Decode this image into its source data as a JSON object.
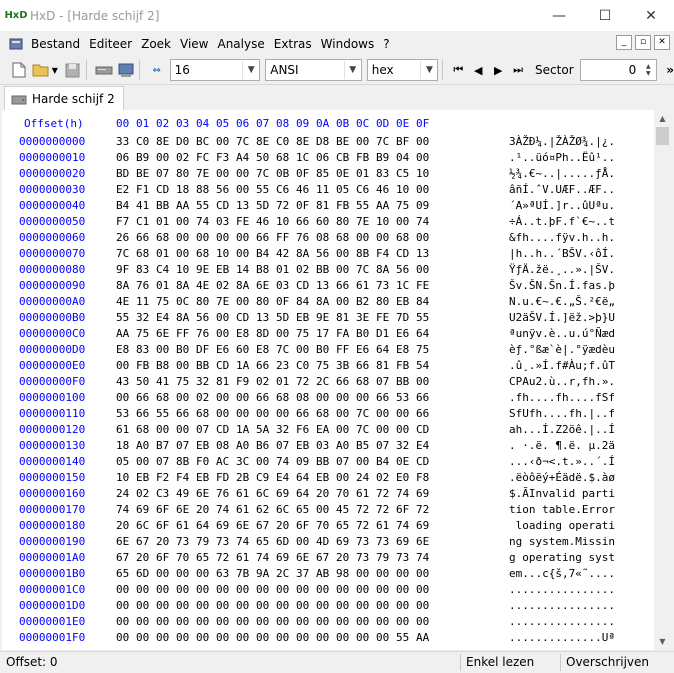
{
  "window": {
    "title": "HxD - [Harde schijf 2]",
    "icon": "HxD",
    "controls": {
      "minimize": "—",
      "maximize": "☐",
      "close": "✕"
    }
  },
  "menu": {
    "items": [
      "Bestand",
      "Editeer",
      "Zoek",
      "View",
      "Analyse",
      "Extras",
      "Windows",
      "?"
    ],
    "mdi": {
      "minimize": "_",
      "restore": "▫",
      "close": "✕"
    }
  },
  "toolbar": {
    "bytes_per_row": "16",
    "charset": "ANSI",
    "offset_base": "hex",
    "sector_label": "Sector",
    "sector_value": "0",
    "more": "»"
  },
  "tabs": [
    {
      "label": "Harde schijf 2"
    }
  ],
  "editor": {
    "offset_header": "Offset(h)",
    "column_headers": [
      "00",
      "01",
      "02",
      "03",
      "04",
      "05",
      "06",
      "07",
      "08",
      "09",
      "0A",
      "0B",
      "0C",
      "0D",
      "0E",
      "0F"
    ],
    "rows": [
      {
        "offset": "0000000000",
        "bytes": [
          "33",
          "C0",
          "8E",
          "D0",
          "BC",
          "00",
          "7C",
          "8E",
          "C0",
          "8E",
          "D8",
          "BE",
          "00",
          "7C",
          "BF",
          "00"
        ],
        "text": "3ÀŽÐ¼.|ŽÀŽØ¾.|¿."
      },
      {
        "offset": "0000000010",
        "bytes": [
          "06",
          "B9",
          "00",
          "02",
          "FC",
          "F3",
          "A4",
          "50",
          "68",
          "1C",
          "06",
          "CB",
          "FB",
          "B9",
          "04",
          "00"
        ],
        "text": ".¹..üó¤Ph..Ëû¹.."
      },
      {
        "offset": "0000000020",
        "bytes": [
          "BD",
          "BE",
          "07",
          "80",
          "7E",
          "00",
          "00",
          "7C",
          "0B",
          "0F",
          "85",
          "0E",
          "01",
          "83",
          "C5",
          "10"
        ],
        "text": "½¾.€~..|.....ƒÅ."
      },
      {
        "offset": "0000000030",
        "bytes": [
          "E2",
          "F1",
          "CD",
          "18",
          "88",
          "56",
          "00",
          "55",
          "C6",
          "46",
          "11",
          "05",
          "C6",
          "46",
          "10",
          "00"
        ],
        "text": "âñÍ.ˆV.UÆF..ÆF.."
      },
      {
        "offset": "0000000040",
        "bytes": [
          "B4",
          "41",
          "BB",
          "AA",
          "55",
          "CD",
          "13",
          "5D",
          "72",
          "0F",
          "81",
          "FB",
          "55",
          "AA",
          "75",
          "09"
        ],
        "text": "´A»ªUÍ.]r..ûUªu."
      },
      {
        "offset": "0000000050",
        "bytes": [
          "F7",
          "C1",
          "01",
          "00",
          "74",
          "03",
          "FE",
          "46",
          "10",
          "66",
          "60",
          "80",
          "7E",
          "10",
          "00",
          "74"
        ],
        "text": "÷Á..t.þF.f`€~..t"
      },
      {
        "offset": "0000000060",
        "bytes": [
          "26",
          "66",
          "68",
          "00",
          "00",
          "00",
          "00",
          "66",
          "FF",
          "76",
          "08",
          "68",
          "00",
          "00",
          "68",
          "00"
        ],
        "text": "&fh....fÿv.h..h."
      },
      {
        "offset": "0000000070",
        "bytes": [
          "7C",
          "68",
          "01",
          "00",
          "68",
          "10",
          "00",
          "B4",
          "42",
          "8A",
          "56",
          "00",
          "8B",
          "F4",
          "CD",
          "13"
        ],
        "text": "|h..h..´BŠV.‹ôÍ."
      },
      {
        "offset": "0000000080",
        "bytes": [
          "9F",
          "83",
          "C4",
          "10",
          "9E",
          "EB",
          "14",
          "B8",
          "01",
          "02",
          "BB",
          "00",
          "7C",
          "8A",
          "56",
          "00"
        ],
        "text": "ŸƒÄ.žë.¸..».|ŠV."
      },
      {
        "offset": "0000000090",
        "bytes": [
          "8A",
          "76",
          "01",
          "8A",
          "4E",
          "02",
          "8A",
          "6E",
          "03",
          "CD",
          "13",
          "66",
          "61",
          "73",
          "1C",
          "FE"
        ],
        "text": "Šv.ŠN.Šn.Í.fas.þ"
      },
      {
        "offset": "00000000A0",
        "bytes": [
          "4E",
          "11",
          "75",
          "0C",
          "80",
          "7E",
          "00",
          "80",
          "0F",
          "84",
          "8A",
          "00",
          "B2",
          "80",
          "EB",
          "84"
        ],
        "text": "N.u.€~.€.„Š.²€ë„"
      },
      {
        "offset": "00000000B0",
        "bytes": [
          "55",
          "32",
          "E4",
          "8A",
          "56",
          "00",
          "CD",
          "13",
          "5D",
          "EB",
          "9E",
          "81",
          "3E",
          "FE",
          "7D",
          "55"
        ],
        "text": "U2äŠV.Í.]ëž.>þ}U"
      },
      {
        "offset": "00000000C0",
        "bytes": [
          "AA",
          "75",
          "6E",
          "FF",
          "76",
          "00",
          "E8",
          "8D",
          "00",
          "75",
          "17",
          "FA",
          "B0",
          "D1",
          "E6",
          "64"
        ],
        "text": "ªunÿv.è..u.ú°Ñæd"
      },
      {
        "offset": "00000000D0",
        "bytes": [
          "E8",
          "83",
          "00",
          "B0",
          "DF",
          "E6",
          "60",
          "E8",
          "7C",
          "00",
          "B0",
          "FF",
          "E6",
          "64",
          "E8",
          "75"
        ],
        "text": "èƒ.°ßæ`è|.°ÿædèu"
      },
      {
        "offset": "00000000E0",
        "bytes": [
          "00",
          "FB",
          "B8",
          "00",
          "BB",
          "CD",
          "1A",
          "66",
          "23",
          "C0",
          "75",
          "3B",
          "66",
          "81",
          "FB",
          "54"
        ],
        "text": ".û¸.»Í.f#Àu;f.ûT"
      },
      {
        "offset": "00000000F0",
        "bytes": [
          "43",
          "50",
          "41",
          "75",
          "32",
          "81",
          "F9",
          "02",
          "01",
          "72",
          "2C",
          "66",
          "68",
          "07",
          "BB",
          "00"
        ],
        "text": "CPAu2.ù..r,fh.»."
      },
      {
        "offset": "0000000100",
        "bytes": [
          "00",
          "66",
          "68",
          "00",
          "02",
          "00",
          "00",
          "66",
          "68",
          "08",
          "00",
          "00",
          "00",
          "66",
          "53",
          "66"
        ],
        "text": ".fh....fh....fSf"
      },
      {
        "offset": "0000000110",
        "bytes": [
          "53",
          "66",
          "55",
          "66",
          "68",
          "00",
          "00",
          "00",
          "00",
          "66",
          "68",
          "00",
          "7C",
          "00",
          "00",
          "66"
        ],
        "text": "SfUfh....fh.|..f"
      },
      {
        "offset": "0000000120",
        "bytes": [
          "61",
          "68",
          "00",
          "00",
          "07",
          "CD",
          "1A",
          "5A",
          "32",
          "F6",
          "EA",
          "00",
          "7C",
          "00",
          "00",
          "CD"
        ],
        "text": "ah...Í.Z2öê.|..Í"
      },
      {
        "offset": "0000000130",
        "bytes": [
          "18",
          "A0",
          "B7",
          "07",
          "EB",
          "08",
          "A0",
          "B6",
          "07",
          "EB",
          "03",
          "A0",
          "B5",
          "07",
          "32",
          "E4"
        ],
        "text": ". ·.ë. ¶.ë. µ.2ä"
      },
      {
        "offset": "0000000140",
        "bytes": [
          "05",
          "00",
          "07",
          "8B",
          "F0",
          "AC",
          "3C",
          "00",
          "74",
          "09",
          "BB",
          "07",
          "00",
          "B4",
          "0E",
          "CD"
        ],
        "text": "...‹ð¬<.t.»..´.Í"
      },
      {
        "offset": "0000000150",
        "bytes": [
          "10",
          "EB",
          "F2",
          "F4",
          "EB",
          "FD",
          "2B",
          "C9",
          "E4",
          "64",
          "EB",
          "00",
          "24",
          "02",
          "E0",
          "F8"
        ],
        "text": ".ëòôëý+Éädë.$.àø"
      },
      {
        "offset": "0000000160",
        "bytes": [
          "24",
          "02",
          "C3",
          "49",
          "6E",
          "76",
          "61",
          "6C",
          "69",
          "64",
          "20",
          "70",
          "61",
          "72",
          "74",
          "69"
        ],
        "text": "$.ÃInvalid parti"
      },
      {
        "offset": "0000000170",
        "bytes": [
          "74",
          "69",
          "6F",
          "6E",
          "20",
          "74",
          "61",
          "62",
          "6C",
          "65",
          "00",
          "45",
          "72",
          "72",
          "6F",
          "72"
        ],
        "text": "tion table.Error"
      },
      {
        "offset": "0000000180",
        "bytes": [
          "20",
          "6C",
          "6F",
          "61",
          "64",
          "69",
          "6E",
          "67",
          "20",
          "6F",
          "70",
          "65",
          "72",
          "61",
          "74",
          "69"
        ],
        "text": " loading operati"
      },
      {
        "offset": "0000000190",
        "bytes": [
          "6E",
          "67",
          "20",
          "73",
          "79",
          "73",
          "74",
          "65",
          "6D",
          "00",
          "4D",
          "69",
          "73",
          "73",
          "69",
          "6E"
        ],
        "text": "ng system.Missin"
      },
      {
        "offset": "00000001A0",
        "bytes": [
          "67",
          "20",
          "6F",
          "70",
          "65",
          "72",
          "61",
          "74",
          "69",
          "6E",
          "67",
          "20",
          "73",
          "79",
          "73",
          "74"
        ],
        "text": "g operating syst"
      },
      {
        "offset": "00000001B0",
        "bytes": [
          "65",
          "6D",
          "00",
          "00",
          "00",
          "63",
          "7B",
          "9A",
          "2C",
          "37",
          "AB",
          "98",
          "00",
          "00",
          "00",
          "00"
        ],
        "text": "em...c{š,7«˜...."
      },
      {
        "offset": "00000001C0",
        "bytes": [
          "00",
          "00",
          "00",
          "00",
          "00",
          "00",
          "00",
          "00",
          "00",
          "00",
          "00",
          "00",
          "00",
          "00",
          "00",
          "00"
        ],
        "text": "................"
      },
      {
        "offset": "00000001D0",
        "bytes": [
          "00",
          "00",
          "00",
          "00",
          "00",
          "00",
          "00",
          "00",
          "00",
          "00",
          "00",
          "00",
          "00",
          "00",
          "00",
          "00"
        ],
        "text": "................"
      },
      {
        "offset": "00000001E0",
        "bytes": [
          "00",
          "00",
          "00",
          "00",
          "00",
          "00",
          "00",
          "00",
          "00",
          "00",
          "00",
          "00",
          "00",
          "00",
          "00",
          "00"
        ],
        "text": "................"
      },
      {
        "offset": "00000001F0",
        "bytes": [
          "00",
          "00",
          "00",
          "00",
          "00",
          "00",
          "00",
          "00",
          "00",
          "00",
          "00",
          "00",
          "00",
          "00",
          "55",
          "AA"
        ],
        "text": "..............Uª"
      }
    ]
  },
  "status": {
    "offset": "Offset: 0",
    "mode": "Enkel lezen",
    "insert": "Overschrijven"
  }
}
